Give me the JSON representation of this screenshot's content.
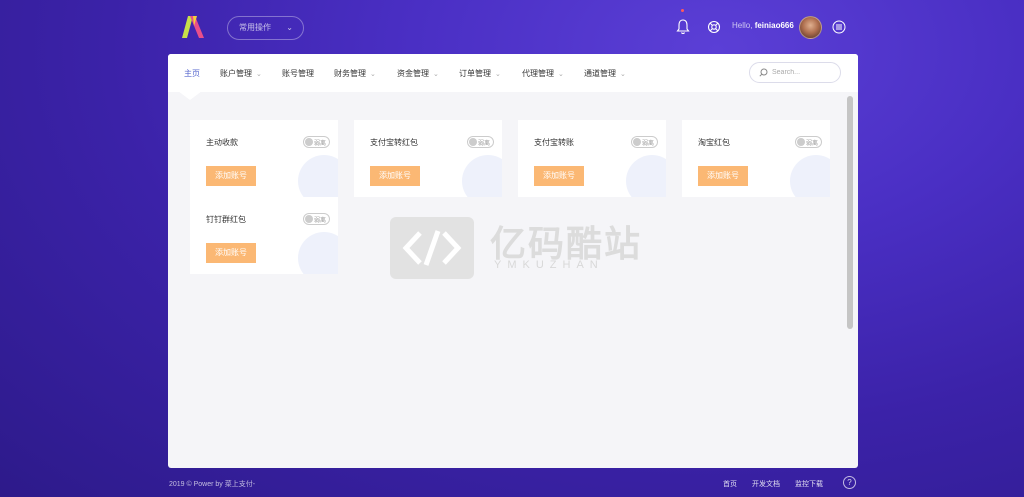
{
  "header": {
    "quick_ops_label": "常用操作",
    "hello_prefix": "Hello,",
    "username": "feiniao666"
  },
  "nav": {
    "items": [
      {
        "label": "主页"
      },
      {
        "label": "账户管理"
      },
      {
        "label": "账号管理"
      },
      {
        "label": "财务管理"
      },
      {
        "label": "资金管理"
      },
      {
        "label": "订单管理"
      },
      {
        "label": "代理管理"
      },
      {
        "label": "通道管理"
      }
    ],
    "search_placeholder": "Search..."
  },
  "cards": [
    {
      "title": "主动收款",
      "toggle_label": "弱离",
      "button": "添加账号"
    },
    {
      "title": "支付宝转红包",
      "toggle_label": "弱离",
      "button": "添加账号"
    },
    {
      "title": "支付宝转账",
      "toggle_label": "弱离",
      "button": "添加账号"
    },
    {
      "title": "淘宝红包",
      "toggle_label": "弱离",
      "button": "添加账号"
    },
    {
      "title": "钉钉群红包",
      "toggle_label": "弱离",
      "button": "添加账号"
    }
  ],
  "watermark": {
    "title": "亿码酷站",
    "subtitle": "YMKUZHAN"
  },
  "footer": {
    "copyright": "2019 © Power by 菜上支付-",
    "links": [
      {
        "label": "首页"
      },
      {
        "label": "开发文档"
      },
      {
        "label": "监控下载"
      }
    ],
    "help": "?"
  },
  "colors": {
    "accent": "#5a6acf",
    "button": "#fbb874"
  },
  "icons": {
    "logo": "brand-logo-icon",
    "bell": "bell-icon",
    "support": "support-icon",
    "menu": "menu-icon",
    "search": "search-icon",
    "help": "help-icon"
  }
}
